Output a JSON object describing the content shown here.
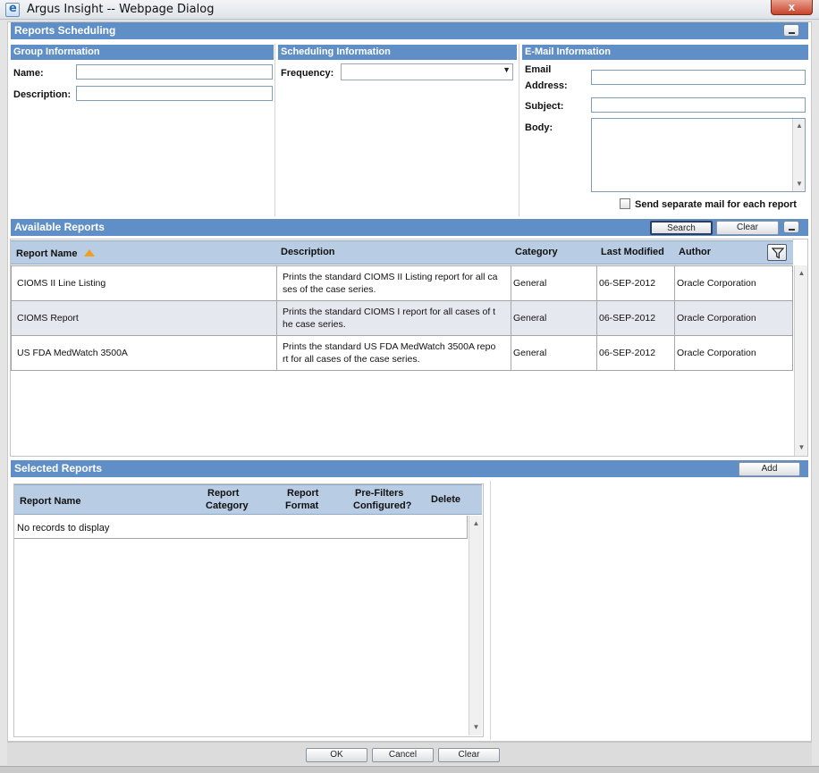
{
  "window": {
    "title": "Argus Insight -- Webpage Dialog",
    "close": "x"
  },
  "dialog": {
    "title": "Reports Scheduling"
  },
  "group": {
    "header": "Group Information",
    "name_label": "Name:",
    "name_value": "",
    "description_label": "Description:",
    "description_value": ""
  },
  "scheduling": {
    "header": "Scheduling Information",
    "frequency_label": "Frequency:",
    "frequency_value": ""
  },
  "email": {
    "header": "E-Mail Information",
    "address_label_1": "Email",
    "address_label_2": "Address:",
    "address_value": "",
    "subject_label": "Subject:",
    "subject_value": "",
    "body_label": "Body:",
    "body_value": "",
    "separate_label": "Send separate mail for each report",
    "separate_checked": false
  },
  "available": {
    "header": "Available Reports",
    "search_label": "Search",
    "clear_label": "Clear",
    "columns": {
      "name": "Report Name",
      "description": "Description",
      "category": "Category",
      "modified": "Last Modified",
      "author": "Author"
    },
    "sort": {
      "column": "Report Name",
      "direction": "ascending"
    },
    "rows": [
      {
        "name": "CIOMS II Line Listing",
        "desc1": "Prints the standard CIOMS II Listing report for all ca",
        "desc2": "ses of the case series.",
        "category": "General",
        "modified": "06-SEP-2012",
        "author": "Oracle Corporation"
      },
      {
        "name": "CIOMS Report",
        "desc1": "Prints the standard CIOMS I report for all cases of t",
        "desc2": "he case series.",
        "category": "General",
        "modified": "06-SEP-2012",
        "author": "Oracle Corporation"
      },
      {
        "name": "US FDA MedWatch 3500A",
        "desc1": "Prints the standard US FDA MedWatch 3500A repo",
        "desc2": "rt for all cases of the case series.",
        "category": "General",
        "modified": "06-SEP-2012",
        "author": "Oracle Corporation"
      }
    ]
  },
  "selected": {
    "header": "Selected Reports",
    "add_label": "Add",
    "columns": {
      "name": "Report Name",
      "category_1": "Report",
      "category_2": "Category",
      "format_1": "Report",
      "format_2": "Format",
      "prefilter_1": "Pre-Filters",
      "prefilter_2": "Configured?",
      "delete": "Delete"
    },
    "empty": "No records to display"
  },
  "footer": {
    "ok": "OK",
    "cancel": "Cancel",
    "clear": "Clear"
  },
  "colors": {
    "header_bar": "#5f8fc6",
    "table_header": "#b8cce4",
    "row_selected": "#e6e8f0"
  }
}
